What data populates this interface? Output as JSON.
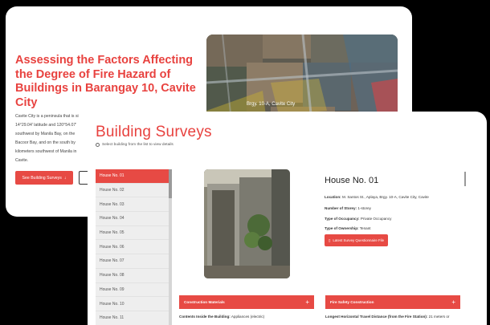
{
  "back": {
    "title": "Assessing the Factors Affecting the Degree of Fire Hazard of Buildings in Barangay 10, Cavite City",
    "intro": "Cavite City is a peninsula that is si\n14°29.04' latitude and 120°54.07'\nsouthwest by Manila Bay, on the\nBacoor Bay, and on the south by\nkilometers southwest of Manila in\nCavite.",
    "see_button": "See Building Surveys",
    "map_label": "Brgy. 10-A, Cavite City"
  },
  "front": {
    "title": "Building Surveys",
    "subtitle": "Select building from the list to view details",
    "houses": [
      "House No. 01",
      "House No. 02",
      "House No. 03",
      "House No. 04",
      "House No. 05",
      "House No. 06",
      "House No. 07",
      "House No. 08",
      "House No. 09",
      "House No. 10",
      "House No. 11"
    ],
    "detail": {
      "title": "House No. 01",
      "location_label": "Location:",
      "location": "M. Santos St., Aplaya, Brgy. 10-A, Cavite City, Cavite",
      "storey_label": "Number of Storey:",
      "storey": "1-storey",
      "occupancy_label": "Type of Occupancy:",
      "occupancy": "Private Occupancy",
      "ownership_label": "Type of Ownership:",
      "ownership": "Tenant",
      "button": "Latest Survey Questionnaire File"
    },
    "sections": {
      "construction": "Construction Materials",
      "contents_label": "Contents Inside the Building:",
      "contents": "Appliances (electric)",
      "fire_safety": "Fire Safety Construction",
      "distance_label": "Longest Horizontal Travel Distance (from the Fire Station):",
      "distance": "21 meters or"
    }
  },
  "colors": {
    "accent": "#e74a44",
    "title_red": "#e8423f"
  },
  "icons": {
    "arrow": "arrow-down-icon",
    "info": "info-icon",
    "file": "file-icon",
    "plus": "plus-icon"
  }
}
